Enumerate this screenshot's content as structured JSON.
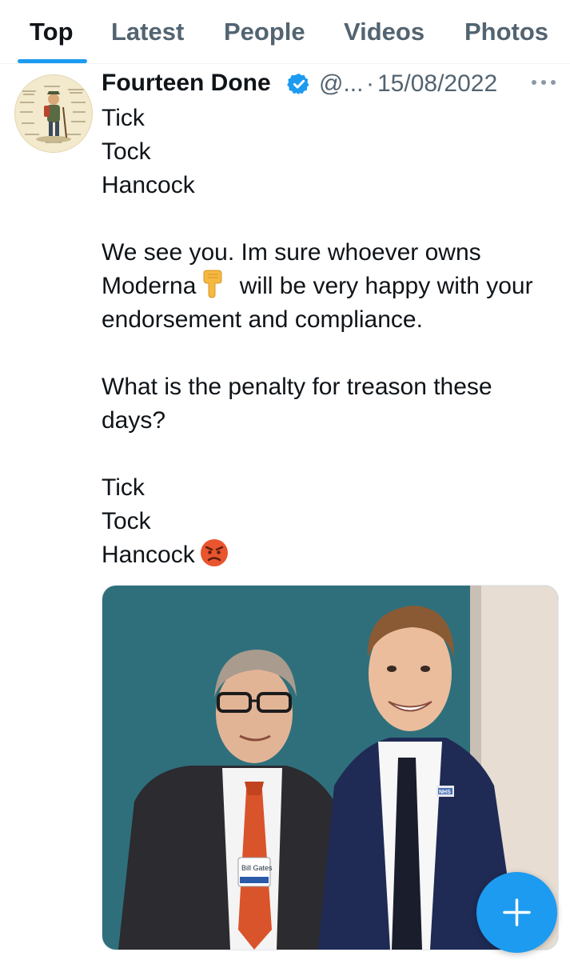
{
  "tabs": [
    {
      "label": "Top",
      "active": true
    },
    {
      "label": "Latest",
      "active": false
    },
    {
      "label": "People",
      "active": false
    },
    {
      "label": "Videos",
      "active": false
    },
    {
      "label": "Photos",
      "active": false
    }
  ],
  "tweet": {
    "author": {
      "display_name": "Fourteen Done",
      "verified": true,
      "handle": "@...",
      "avatar_icon": "cartoon-hiker-avatar"
    },
    "separator": "·",
    "date": "15/08/2022",
    "more_icon": "more-horizontal-icon",
    "text": {
      "line1": "Tick",
      "line2": "Tock",
      "line3": "Hancock",
      "p2_part1": "We see you. Im sure whoever owns Moderna",
      "p2_emoji": "backhand-index-pointing-down-emoji",
      "p2_part2": "will be very happy with your endorsement and compliance.",
      "p3": "What is the penalty for treason these days?",
      "line4": "Tick",
      "line5": "Tock",
      "line6": "Hancock",
      "end_emoji": "angry-face-emoji"
    },
    "media": {
      "description_icon": "photo-two-men-in-suits",
      "badge_text_1": "Bill Gates",
      "lapel_badge": "NHS"
    }
  },
  "fab": {
    "icon": "plus-icon"
  },
  "colors": {
    "accent": "#1d9bf0",
    "text": "#0f1419",
    "secondary": "#536471"
  }
}
